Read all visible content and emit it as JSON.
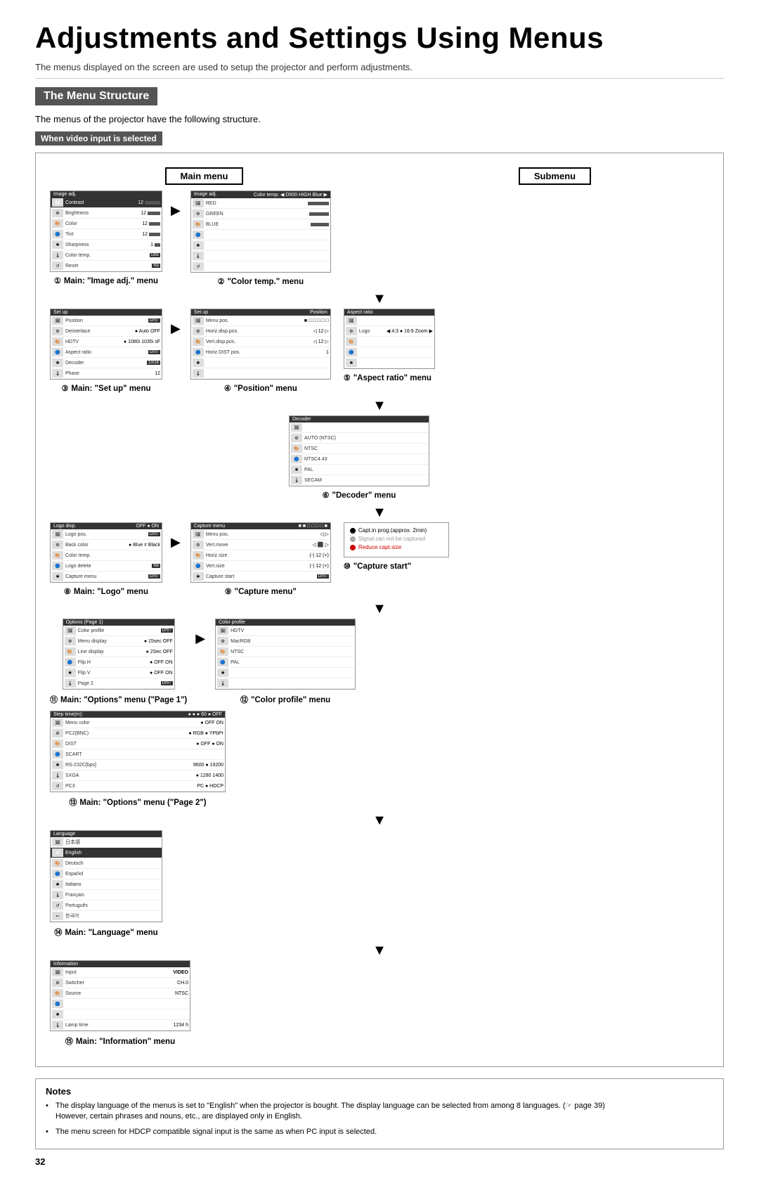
{
  "page": {
    "title": "Adjustments and Settings Using Menus",
    "subtitle": "The menus displayed on the screen are used to setup the projector and perform adjustments.",
    "section_title": "The Menu Structure",
    "section_intro": "The menus of the projector have the following structure.",
    "video_input_label": "When video input is selected",
    "main_menu_label": "Main menu",
    "submenu_label": "Submenu",
    "page_number": "32"
  },
  "menu_items": [
    {
      "num": "1",
      "label": "Main: “Image adj.” menu"
    },
    {
      "num": "2",
      "label": "“Color temp.” menu"
    },
    {
      "num": "3",
      "label": "Main: “Set up” menu"
    },
    {
      "num": "4",
      "label": "“Position” menu"
    },
    {
      "num": "5",
      "label": "“Aspect ratio” menu"
    },
    {
      "num": "6",
      "label": "“Decoder” menu"
    },
    {
      "num": "8",
      "label": "Main: “Logo” menu"
    },
    {
      "num": "9",
      "label": "“Capture menu”"
    },
    {
      "num": "10",
      "label": "“Capture start”"
    },
    {
      "num": "11",
      "label": "Main: “Options” menu (“Page 1”)"
    },
    {
      "num": "12",
      "label": "“Color profile” menu"
    },
    {
      "num": "13",
      "label": "Main: “Options” menu (“Page 2”)"
    },
    {
      "num": "14",
      "label": "Main: “Language” menu"
    },
    {
      "num": "15",
      "label": "Main: “Information” menu"
    }
  ],
  "notes": {
    "title": "Notes",
    "items": [
      "The display language of the menus is set to “English” when the projector is bought. The display language can be selected from among 8 languages. (→ page 39)\nHowever, certain phrases and nouns, etc., are displayed only in English.",
      "The menu screen for HDCP compatible signal input is the same as when PC input is selected."
    ]
  }
}
